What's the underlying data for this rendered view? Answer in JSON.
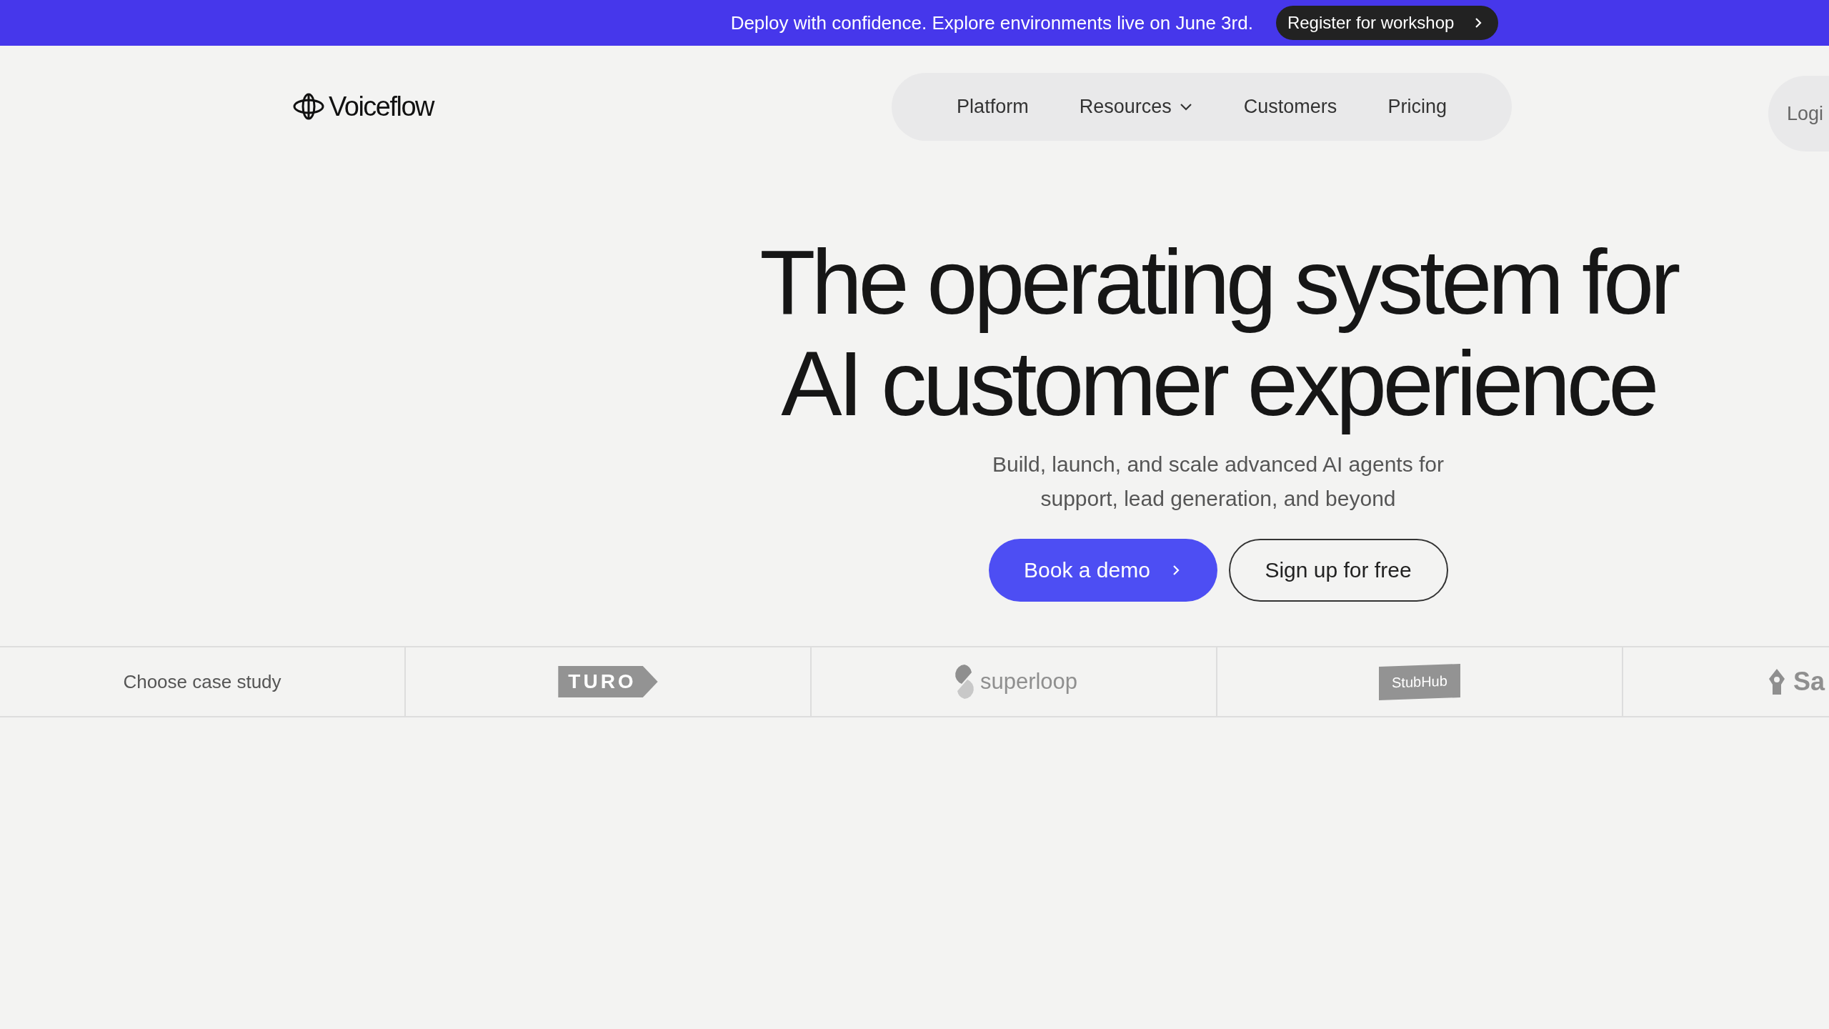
{
  "banner": {
    "text": "Deploy with confidence. Explore environments live on June 3rd.",
    "button": "Register for workshop"
  },
  "header": {
    "logo": "Voiceflow",
    "nav": [
      {
        "label": "Platform",
        "kind": "link"
      },
      {
        "label": "Resources",
        "kind": "dropdown"
      },
      {
        "label": "Customers",
        "kind": "link"
      },
      {
        "label": "Pricing",
        "kind": "link"
      }
    ],
    "login": "Logi"
  },
  "hero": {
    "title": [
      "The operating system for",
      "AI customer experience"
    ],
    "subtitle": [
      "Build, launch, and scale advanced AI agents for",
      "support, lead generation, and beyond"
    ],
    "primary_button": "Book a demo",
    "secondary_button": "Sign up for free"
  },
  "case_studies": {
    "label": "Choose case study",
    "logos": [
      {
        "kind": "turo",
        "text": "TURO"
      },
      {
        "kind": "superloop",
        "text": "superloop"
      },
      {
        "kind": "stubhub",
        "text": "StubHub"
      },
      {
        "kind": "sa",
        "text": "Sa"
      }
    ]
  }
}
